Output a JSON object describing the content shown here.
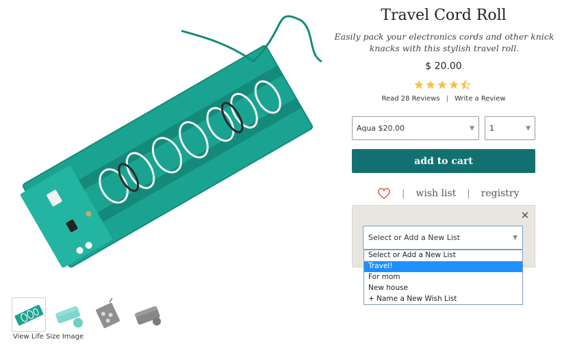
{
  "product": {
    "title": "Travel Cord Roll",
    "subtitle": "Easily pack your electronics cords and other knick knacks with this stylish travel roll.",
    "price": "$ 20.00",
    "rating": 4.5,
    "rating_max": 5,
    "reviews_link": "Read 28 Reviews",
    "write_review": "Write a Review",
    "separator": "|"
  },
  "options": {
    "variant": "Aqua $20.00",
    "quantity": "1"
  },
  "actions": {
    "add_to_cart": "add to cart",
    "wish_list": "wish list",
    "registry": "registry",
    "divider": "|"
  },
  "gallery": {
    "view_life_size": "View Life Size Image"
  },
  "wishlist_popup": {
    "close_glyph": "✕",
    "select_value": "Select or Add a New List",
    "options": [
      "Select or Add a New List",
      "Travel!",
      "For mom",
      "New house",
      "+ Name a New Wish List"
    ],
    "highlighted_index": 1
  },
  "colors": {
    "accent": "#127170",
    "leather": "#1aa391",
    "star": "#f2c14e",
    "heart": "#d9534f",
    "highlight": "#1e90ff"
  }
}
